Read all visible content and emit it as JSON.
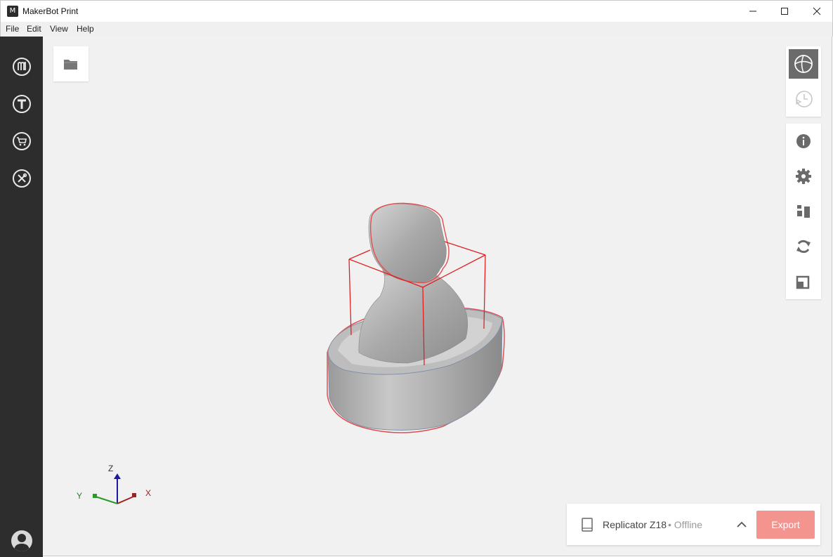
{
  "window": {
    "title": "MakerBot Print",
    "app_icon_glyph": "M"
  },
  "menu": [
    "File",
    "Edit",
    "View",
    "Help"
  ],
  "sidebar": {
    "items": [
      {
        "icon": "makerbot-logo-icon"
      },
      {
        "icon": "thingiverse-icon"
      },
      {
        "icon": "store-cart-icon"
      },
      {
        "icon": "tools-icon"
      }
    ]
  },
  "view_tools": [
    {
      "icon": "model-view-icon",
      "active": true
    },
    {
      "icon": "print-preview-icon",
      "active": false
    }
  ],
  "model_tools": [
    {
      "icon": "info-icon"
    },
    {
      "icon": "settings-gear-icon"
    },
    {
      "icon": "arrange-icon"
    },
    {
      "icon": "rotate-icon"
    },
    {
      "icon": "scale-icon"
    }
  ],
  "axes": {
    "x": "X",
    "y": "Y",
    "z": "Z"
  },
  "printer": {
    "name": "Replicator Z18",
    "status": "• Offline"
  },
  "export_label": "Export",
  "colors": {
    "sidebar": "#2d2d2d",
    "viewport": "#f1f1f1",
    "export": "#f4948f",
    "bounding_box": "#e02020",
    "active_tool": "#6b6b6b"
  }
}
